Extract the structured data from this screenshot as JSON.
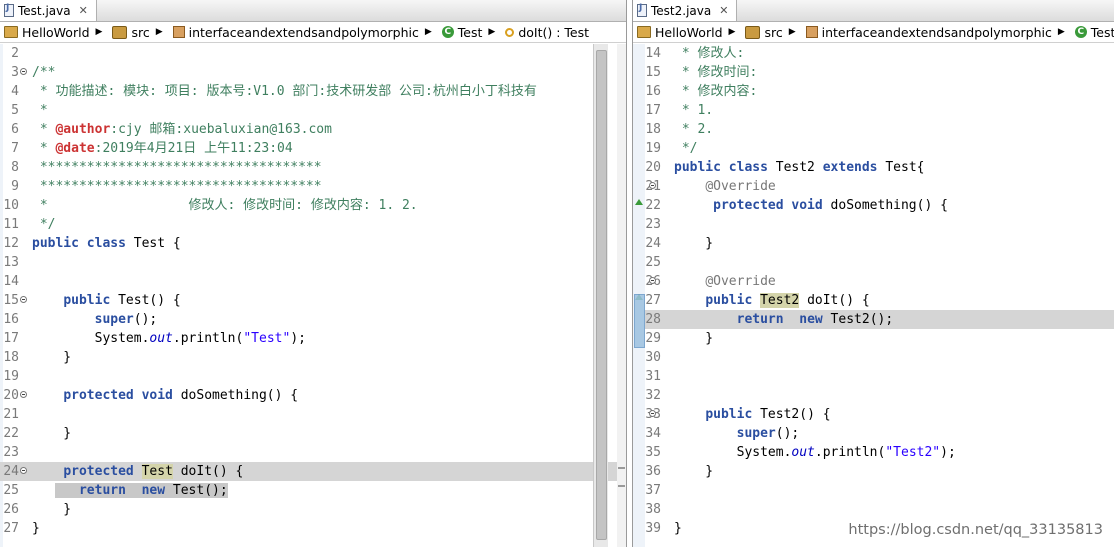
{
  "left": {
    "tab": {
      "label": "Test.java",
      "close": "✕"
    },
    "breadcrumb": [
      "HelloWorld",
      "src",
      "interfaceandextendsandpolymorphic",
      "Test",
      "doIt() : Test"
    ],
    "lines": [
      {
        "n": "2",
        "html": ""
      },
      {
        "n": "3",
        "fold": true,
        "html": "<span class='cm'>/**</span>"
      },
      {
        "n": "4",
        "html": "<span class='cm'> * 功能描述: 模块: 项目: 版本号:V1.0 部门:技术研发部 公司:杭州白小丁科技有</span>"
      },
      {
        "n": "5",
        "html": "<span class='cm'> *</span>"
      },
      {
        "n": "6",
        "html": "<span class='cm'> * </span><span class='tag'>@author</span><span class='cm'>:cjy 邮箱:xuebaluxian@163.com</span>"
      },
      {
        "n": "7",
        "html": "<span class='cm'> * </span><span class='tag'>@date</span><span class='cm'>:2019年4月21日 上午11:23:04</span>"
      },
      {
        "n": "8",
        "html": "<span class='cm'> ************************************</span>"
      },
      {
        "n": "9",
        "html": "<span class='cm'> ************************************</span>"
      },
      {
        "n": "10",
        "html": "<span class='cm'> *                  修改人: 修改时间: 修改内容: 1. 2.</span>"
      },
      {
        "n": "11",
        "html": "<span class='cm'> */</span>"
      },
      {
        "n": "12",
        "html": "<span class='kw'>public class</span> Test {"
      },
      {
        "n": "13",
        "html": ""
      },
      {
        "n": "14",
        "html": ""
      },
      {
        "n": "15",
        "fold": true,
        "html": "    <span class='kw'>public</span> Test() {"
      },
      {
        "n": "16",
        "html": "        <span class='kw'>super</span>();"
      },
      {
        "n": "17",
        "html": "        System.<span class='fi'>out</span>.println(<span class='st'>\"Test\"</span>);"
      },
      {
        "n": "18",
        "html": "    }"
      },
      {
        "n": "19",
        "html": ""
      },
      {
        "n": "20",
        "fold": true,
        "html": "    <span class='kw'>protected void</span> doSomething() {"
      },
      {
        "n": "21",
        "html": ""
      },
      {
        "n": "22",
        "html": "    }"
      },
      {
        "n": "23",
        "html": ""
      },
      {
        "n": "24",
        "fold": true,
        "hl": true,
        "html": "    <span class='kw'>protected</span> <span class='occ'>Test</span> doIt() {"
      },
      {
        "n": "25",
        "html": "   <span class='sel'>   <span class='kw'>return</span>  <span class='kw'>new</span> Test();</span>"
      },
      {
        "n": "26",
        "html": "    }"
      },
      {
        "n": "27",
        "html": "}"
      }
    ]
  },
  "right": {
    "tab": {
      "label": "Test2.java",
      "close": "✕"
    },
    "breadcrumb": [
      "HelloWorld",
      "src",
      "interfaceandextendsandpolymorphic",
      "Test"
    ],
    "lines": [
      {
        "n": "14",
        "html": "<span class='cm'> * 修改人:</span>"
      },
      {
        "n": "15",
        "html": "<span class='cm'> * 修改时间:</span>"
      },
      {
        "n": "16",
        "html": "<span class='cm'> * 修改内容:</span>"
      },
      {
        "n": "17",
        "html": "<span class='cm'> * 1.</span>"
      },
      {
        "n": "18",
        "html": "<span class='cm'> * 2.</span>"
      },
      {
        "n": "19",
        "html": "<span class='cm'> */</span>"
      },
      {
        "n": "20",
        "html": "<span class='kw'>public class</span> Test2 <span class='kw'>extends</span> Test{"
      },
      {
        "n": "21",
        "fold": true,
        "html": "    <span class='an'>@Override</span>"
      },
      {
        "n": "22",
        "html": "     <span class='kw'>protected void</span> doSomething() {"
      },
      {
        "n": "23",
        "html": ""
      },
      {
        "n": "24",
        "html": "    }"
      },
      {
        "n": "25",
        "html": ""
      },
      {
        "n": "26",
        "fold": true,
        "html": "    <span class='an'>@Override</span>"
      },
      {
        "n": "27",
        "html": "    <span class='kw'>public</span> <span class='occ'>Test2</span> doIt() {"
      },
      {
        "n": "28",
        "hl": true,
        "html": "        <span class='kw'>return</span>  <span class='kw'>new</span> Test2();"
      },
      {
        "n": "29",
        "html": "    }"
      },
      {
        "n": "30",
        "html": ""
      },
      {
        "n": "31",
        "html": ""
      },
      {
        "n": "32",
        "html": ""
      },
      {
        "n": "33",
        "fold": true,
        "html": "    <span class='kw'>public</span> Test2() {"
      },
      {
        "n": "34",
        "html": "        <span class='kw'>super</span>();"
      },
      {
        "n": "35",
        "html": "        System.<span class='fi'>out</span>.println(<span class='st'>\"Test2\"</span>);"
      },
      {
        "n": "36",
        "html": "    }"
      },
      {
        "n": "37",
        "html": ""
      },
      {
        "n": "38",
        "html": ""
      },
      {
        "n": "39",
        "html": "}"
      }
    ]
  },
  "watermark": "https://blog.csdn.net/qq_33135813",
  "colors": {
    "keyword": "#2a4ea0",
    "comment": "#3f7f5f",
    "tag": "#cc3333",
    "string": "#2a00ff",
    "highlight_line": "#d5d5d5",
    "occurrence": "#d4d4aa"
  }
}
